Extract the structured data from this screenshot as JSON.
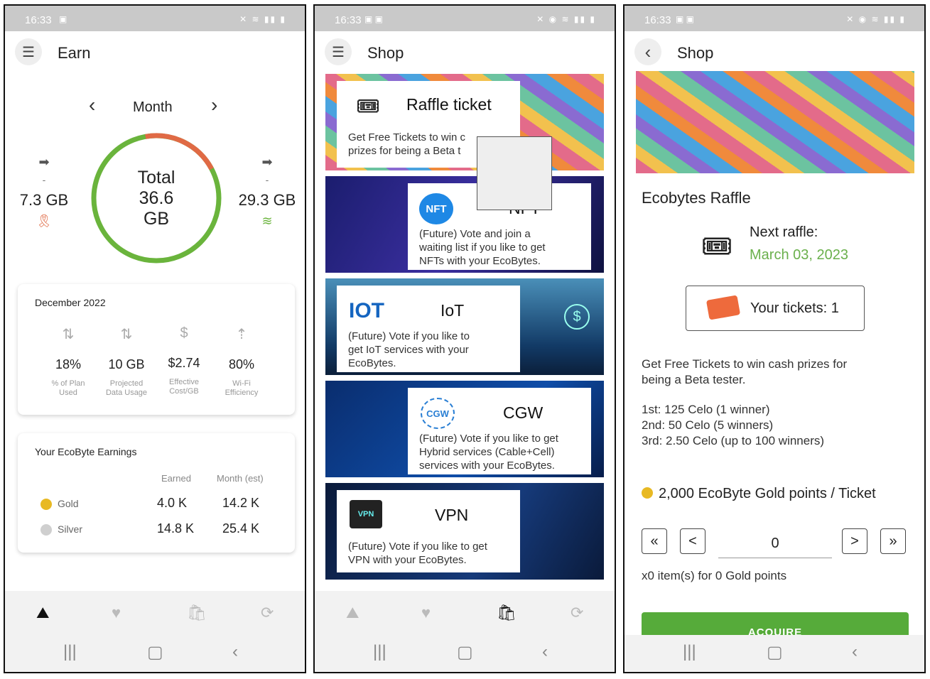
{
  "status": {
    "time": "16:33"
  },
  "earn": {
    "title": "Earn",
    "period_label": "Month",
    "left_value": "7.3 GB",
    "right_value": "29.3 GB",
    "total_line1": "Total",
    "total_line2": "36.6",
    "total_line3": "GB",
    "left_dash": "-",
    "right_dash": "-",
    "ring": {
      "used_color": "#e06a45",
      "remaining_color": "#6ab43c",
      "used_fraction": 0.2
    },
    "summary": {
      "title": "December 2022",
      "metrics": [
        {
          "value": "18%",
          "label1": "% of Plan",
          "label2": "Used",
          "icon": "up-down-arrows-icon"
        },
        {
          "value": "10 GB",
          "label1": "Projected",
          "label2": "Data Usage",
          "icon": "up-down-arrows-icon"
        },
        {
          "value": "$2.74",
          "label1": "Effective",
          "label2": "Cost/GB",
          "icon": "dollar-icon"
        },
        {
          "value": "80%",
          "label1": "Wi-Fi",
          "label2": "Efficiency",
          "icon": "wifi-arrow-icon"
        }
      ]
    },
    "earnings": {
      "title": "Your EcoByte Earnings",
      "col_earned": "Earned",
      "col_month": "Month (est)",
      "rows": [
        {
          "name": "Gold",
          "earned": "4.0 K",
          "month": "14.2 K",
          "color": "#e8b923"
        },
        {
          "name": "Silver",
          "earned": "14.8 K",
          "month": "25.4 K",
          "color": "#cfcfcf"
        }
      ]
    }
  },
  "shop": {
    "title": "Shop",
    "items": [
      {
        "title": "Raffle ticket",
        "desc1": "Get Free Tickets to win c",
        "desc2": "prizes for being a Beta t"
      },
      {
        "title": "NFT",
        "desc1": "(Future) Vote and join a",
        "desc2": "waiting list  if you like to get",
        "desc3": "NFTs with your EcoBytes.",
        "icon_text": "NFT"
      },
      {
        "title": "IoT",
        "desc1": "(Future) Vote if you like to",
        "desc2": "get IoT services with your",
        "desc3": "EcoBytes.",
        "icon_text": "IOT"
      },
      {
        "title": "CGW",
        "desc1": "(Future) Vote if you like to get",
        "desc2": "Hybrid services (Cable+Cell)",
        "desc3": "services with your EcoBytes.",
        "icon_text": "CGW"
      },
      {
        "title": "VPN",
        "desc1": "(Future) Vote if you like to get",
        "desc2": "VPN with your EcoBytes.",
        "icon_text": "VPN"
      }
    ]
  },
  "raffle": {
    "title": "Shop",
    "heading": "Ecobytes Raffle",
    "next_label": "Next raffle:",
    "next_date": "March 03, 2023",
    "tickets_label": "Your tickets: 1",
    "desc1": "Get Free Tickets to win cash prizes for",
    "desc2": "being a Beta tester.",
    "prize1": "1st: 125 Celo (1 winner)",
    "prize2": "2nd: 50 Celo (5 winners)",
    "prize3": "3rd: 2.50 Celo (up to 100 winners)",
    "price": "2,000 EcoByte Gold points / Ticket",
    "quantity": "0",
    "summary": "x0 item(s) for 0 Gold points",
    "acquire": "ACQUIRE",
    "step_first": "«",
    "step_prev": "<",
    "step_next": ">",
    "step_last": "»"
  }
}
